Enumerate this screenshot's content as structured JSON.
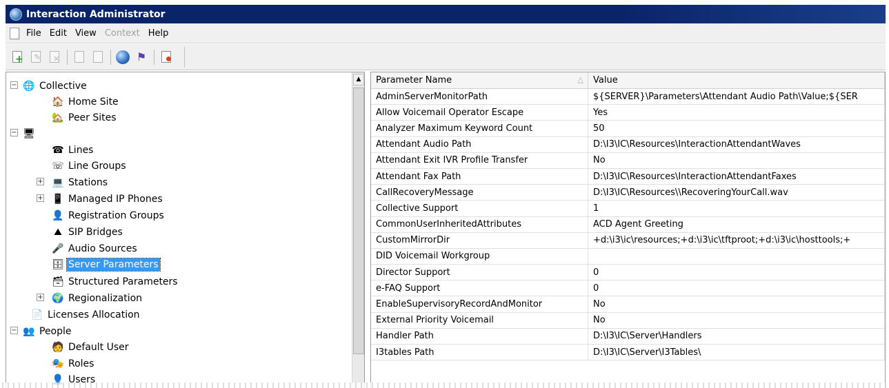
{
  "window": {
    "title": "Interaction Administrator"
  },
  "menu": {
    "items": [
      {
        "label": "File",
        "enabled": true
      },
      {
        "label": "Edit",
        "enabled": true
      },
      {
        "label": "View",
        "enabled": true
      },
      {
        "label": "Context",
        "enabled": false
      },
      {
        "label": "Help",
        "enabled": true
      }
    ]
  },
  "tree": {
    "items": [
      {
        "label": "Collective",
        "icon": "collective-icon",
        "expander": "⊟",
        "selected": false
      },
      {
        "label": "Home Site",
        "icon": "home-site-icon",
        "expander": "",
        "selected": false
      },
      {
        "label": "Peer Sites",
        "icon": "peer-sites-icon",
        "expander": "",
        "selected": false
      },
      {
        "label": "",
        "icon": "server-icon",
        "expander": "⊟",
        "selected": false
      },
      {
        "label": "Lines",
        "icon": "lines-icon",
        "expander": "",
        "selected": false
      },
      {
        "label": "Line Groups",
        "icon": "line-groups-icon",
        "expander": "",
        "selected": false
      },
      {
        "label": "Stations",
        "icon": "stations-icon",
        "expander": "⊞",
        "selected": false
      },
      {
        "label": "Managed IP Phones",
        "icon": "phone-icon",
        "expander": "⊞",
        "selected": false
      },
      {
        "label": "Registration Groups",
        "icon": "registration-icon",
        "expander": "",
        "selected": false
      },
      {
        "label": "SIP Bridges",
        "icon": "sip-bridge-icon",
        "expander": "",
        "selected": false
      },
      {
        "label": "Audio Sources",
        "icon": "audio-icon",
        "expander": "",
        "selected": false
      },
      {
        "label": "Server Parameters",
        "icon": "server-parameters-icon",
        "expander": "",
        "selected": true
      },
      {
        "label": "Structured Parameters",
        "icon": "structured-params-icon",
        "expander": "",
        "selected": false
      },
      {
        "label": "Regionalization",
        "icon": "globe-icon",
        "expander": "⊞",
        "selected": false
      },
      {
        "label": "Licenses Allocation",
        "icon": "license-icon",
        "expander": "",
        "selected": false
      },
      {
        "label": "People",
        "icon": "people-icon",
        "expander": "⊟",
        "selected": false
      },
      {
        "label": "Default User",
        "icon": "default-user-icon",
        "expander": "",
        "selected": false
      },
      {
        "label": "Roles",
        "icon": "roles-icon",
        "expander": "",
        "selected": false
      },
      {
        "label": "Users",
        "icon": "users-icon",
        "expander": "",
        "selected": false
      }
    ]
  },
  "grid": {
    "columns": {
      "name": "Parameter Name",
      "value": "Value"
    },
    "rows": [
      {
        "name": "AdminServerMonitorPath",
        "value": "${SERVER}\\Parameters\\Attendant Audio Path\\Value;${SER"
      },
      {
        "name": "Allow Voicemail Operator Escape",
        "value": "Yes"
      },
      {
        "name": "Analyzer Maximum Keyword Count",
        "value": "50"
      },
      {
        "name": "Attendant Audio Path",
        "value": "D:\\I3\\IC\\Resources\\InteractionAttendantWaves"
      },
      {
        "name": "Attendant Exit IVR Profile Transfer",
        "value": "No"
      },
      {
        "name": "Attendant Fax Path",
        "value": "D:\\I3\\IC\\Resources\\InteractionAttendantFaxes"
      },
      {
        "name": "CallRecoveryMessage",
        "value": "D:\\I3\\IC\\Resources\\\\RecoveringYourCall.wav"
      },
      {
        "name": "Collective Support",
        "value": "1"
      },
      {
        "name": "CommonUserInheritedAttributes",
        "value": "ACD Agent Greeting"
      },
      {
        "name": "CustomMirrorDir",
        "value": "+d:\\i3\\ic\\resources;+d:\\i3\\ic\\tftproot;+d:\\i3\\ic\\hosttools;+"
      },
      {
        "name": "DID Voicemail Workgroup",
        "value": ""
      },
      {
        "name": "Director Support",
        "value": "0"
      },
      {
        "name": "e-FAQ Support",
        "value": "0"
      },
      {
        "name": "EnableSupervisoryRecordAndMonitor",
        "value": "No"
      },
      {
        "name": "External Priority Voicemail",
        "value": "No"
      },
      {
        "name": "Handler Path",
        "value": "D:\\I3\\IC\\Server\\Handlers"
      },
      {
        "name": "I3tables Path",
        "value": "D:\\I3\\IC\\Server\\I3Tables\\"
      }
    ]
  }
}
